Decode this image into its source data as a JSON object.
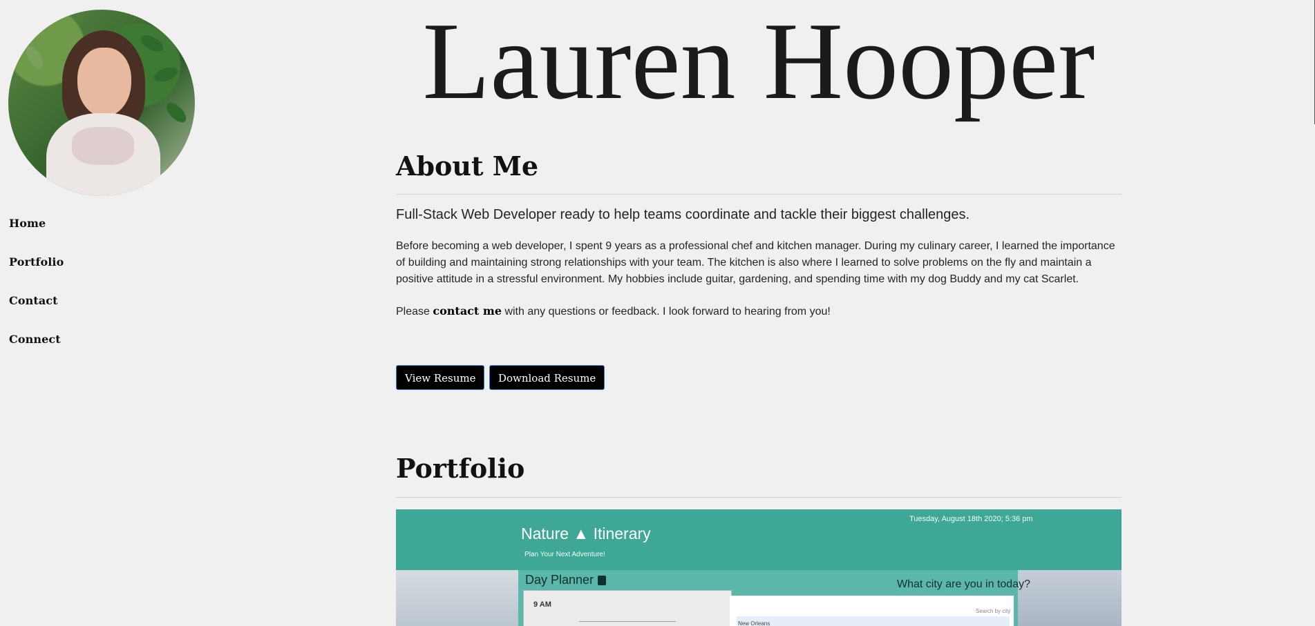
{
  "sidebar": {
    "avatar_alt": "Lauren Hooper portrait",
    "nav": [
      {
        "label": "Home"
      },
      {
        "label": "Portfolio"
      },
      {
        "label": "Contact"
      },
      {
        "label": "Connect"
      }
    ]
  },
  "header": {
    "name": "Lauren Hooper"
  },
  "about": {
    "title": "About Me",
    "lead": "Full-Stack Web Developer ready to help teams coordinate and tackle their biggest challenges.",
    "body": "Before becoming a web developer, I spent 9 years as a professional chef and kitchen manager. During my culinary career, I learned the importance of building and maintaining strong relationships with your team. The kitchen is also where I learned to solve problems on the fly and maintain a positive attitude in a stressful environment. My hobbies include guitar, gardening, and spending time with my dog Buddy and my cat Scarlet.",
    "contact_prefix": "Please ",
    "contact_link": "contact me",
    "contact_suffix": " with any questions or feedback. I look forward to hearing from you!",
    "buttons": {
      "view": "View Resume",
      "download": "Download Resume"
    }
  },
  "portfolio": {
    "title": "Portfolio",
    "preview": {
      "app_name": "Nature ▲ Itinerary",
      "tagline": "Plan Your Next Adventure!",
      "date": "Tuesday, August 18th 2020; 5:36 pm",
      "planner_title": "Day Planner",
      "city_question": "What city are you in today?",
      "hour": "9 AM",
      "search_label": "Search by city",
      "search_value": "New Orleans"
    }
  },
  "colors": {
    "background": "#f0f0f0",
    "button": "#000000",
    "button_border": "#3b7ddd",
    "preview_header": "#3fa796"
  }
}
